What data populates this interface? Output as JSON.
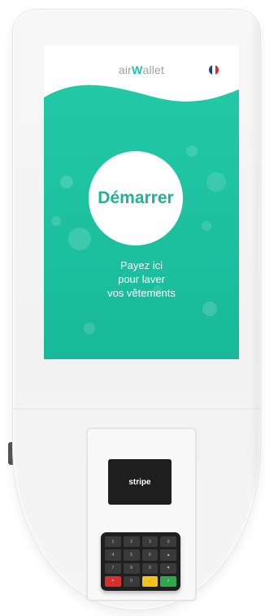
{
  "screen": {
    "brand": {
      "part1": "air",
      "part2": "W",
      "part3": "allet"
    },
    "language_flag": "fr-flag-icon",
    "start_button_label": "Démarrer",
    "tagline": [
      "Payez ici",
      "pour laver",
      "vos vêtements"
    ]
  },
  "reader": {
    "card_brand": "stripe",
    "keys": [
      "1",
      "2",
      "3",
      "0",
      "4",
      "5",
      "6",
      "▲",
      "7",
      "8",
      "9",
      "▼",
      "×",
      "0",
      "←",
      "✓"
    ]
  },
  "colors": {
    "accent": "#20c4a4",
    "accent_dark": "#1cb598",
    "flag_blue": "#1c3f94",
    "flag_red": "#e1252b",
    "keypad": "#1f1f1f"
  }
}
